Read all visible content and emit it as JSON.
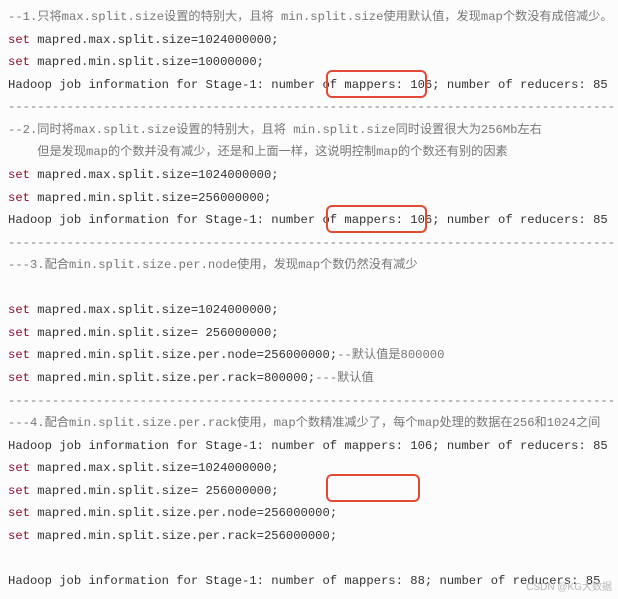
{
  "s1": {
    "c1": "--1.只将max.split.size设置的特别大，且将 min.split.size使用默认值，发现map个数没有成倍减少。",
    "l1a": "set",
    "l1b": " mapred.max.split.size=1024000000;",
    "l2a": "set",
    "l2b": " mapred.min.split.size=10000000;",
    "l3": "Hadoop job information for Stage-1: number of mappers: 106; number of reducers: 85"
  },
  "sep1": "-----------------------------------------------------------------------------------",
  "s2": {
    "c1": "--2.同时将max.split.size设置的特别大，且将 min.split.size同时设置很大为256Mb左右",
    "c2": "    但是发现map的个数并没有减少，还是和上面一样，这说明控制map的个数还有别的因素",
    "l1a": "set",
    "l1b": " mapred.max.split.size=1024000000;",
    "l2a": "set",
    "l2b": " mapred.min.split.size=256000000;",
    "l3": "Hadoop job information for Stage-1: number of mappers: 106; number of reducers: 85"
  },
  "sep2": "-----------------------------------------------------------------------------------",
  "s3": {
    "c1": "---3.配合min.split.size.per.node使用，发现map个数仍然没有减少",
    "blank": " ",
    "l1a": "set",
    "l1b": " mapred.max.split.size=1024000000;",
    "l2a": "set",
    "l2b": " mapred.min.split.size= 256000000;",
    "l3a": "set",
    "l3b": " mapred.min.split.size.per.node=256000000;",
    "l3c": "--默认值是800000",
    "l4a": "set",
    "l4b": " mapred.min.split.size.per.rack=800000;",
    "l4c": "---默认值"
  },
  "sep3": "-----------------------------------------------------------------------------------",
  "s4": {
    "c1": "---4.配合min.split.size.per.rack使用，map个数精准减少了，每个map处理的数据在256和1024之间",
    "l0": "Hadoop job information for Stage-1: number of mappers: 106; number of reducers: 85",
    "l1a": "set",
    "l1b": " mapred.max.split.size=1024000000;",
    "l2a": "set",
    "l2b": " mapred.min.split.size= 256000000;",
    "l3a": "set",
    "l3b": " mapred.min.split.size.per.node=256000000;",
    "l4a": "set",
    "l4b": " mapred.min.split.size.per.rack=256000000;",
    "blank": " ",
    "l5": "Hadoop job information for Stage-1: number of mappers: 88; number of reducers: 85"
  },
  "watermark": "CSDN @KG大数据"
}
